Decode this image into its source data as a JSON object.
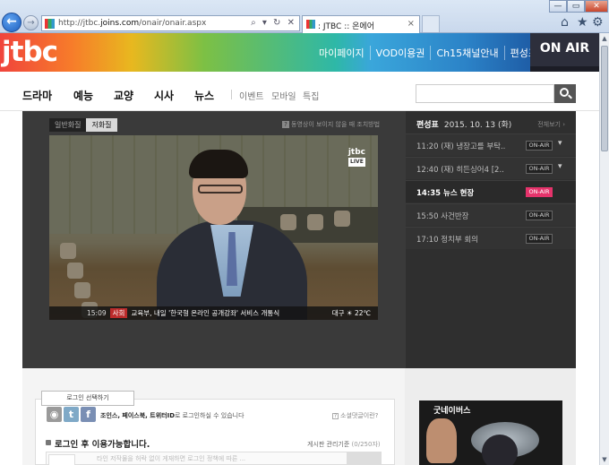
{
  "browser": {
    "url_prefix": "http://jtbc.",
    "url_domain": "joins.com",
    "url_path": "/onair/onair.aspx",
    "url_tools": "⌕ ▾ ↻ ✕",
    "tab_title": ": JTBC :: 온에어",
    "tab_close": "×",
    "back_glyph": "←",
    "fwd_glyph": "→",
    "min_glyph": "—",
    "max_glyph": "▭",
    "close_glyph": "✕",
    "home_glyph": "⌂",
    "fav_glyph": "★",
    "settings_glyph": "⚙"
  },
  "header": {
    "logo": "jtbc",
    "top_menu": [
      "마이페이지",
      "VOD이용권",
      "Ch15채널안내",
      "편성표"
    ],
    "on_air": "ON AIR"
  },
  "gnb": {
    "main": [
      "드라마",
      "예능",
      "교양",
      "시사",
      "뉴스"
    ],
    "sub": [
      "이벤트",
      "모바일",
      "특집"
    ],
    "search_placeholder": ""
  },
  "player": {
    "quality_tabs": [
      "일반화질",
      "저화질"
    ],
    "help_icon": "?",
    "help_text": "동영상이 보이지 않을 때 조치방법",
    "live_logo": "jtbc",
    "live_label": "LIVE",
    "ticker_time": "15:09",
    "ticker_section": "사회",
    "ticker_text": "교육부, 내일 '한국형 온라인 공개강좌' 서비스 개통식",
    "ticker_weather": "대구 ☀ 22℃"
  },
  "schedule": {
    "heading": "편성표",
    "date": "2015. 10. 13 (화)",
    "view_all": "전체보기 ›",
    "items": [
      {
        "time_title": "11:20 (재) 냉장고를 부탁..",
        "badge": "ON-AIR",
        "chevron": "▾"
      },
      {
        "time_title": "12:40 (재) 히든싱어4 [2..",
        "badge": "ON-AIR",
        "chevron": "▾"
      },
      {
        "time_title": "14:35 뉴스 현장",
        "badge": "ON-AIR",
        "chevron": ""
      },
      {
        "time_title": "15:50 사건반장",
        "badge": "ON-AIR",
        "chevron": ""
      },
      {
        "time_title": "17:10 정치부 회의",
        "badge": "ON-AIR",
        "chevron": ""
      }
    ]
  },
  "comments": {
    "login_tip": "로그인 선택하기",
    "sns_glyphs": [
      "◉",
      "t",
      "f"
    ],
    "sns_desc_bold": "조인스, 페이스북, 트위터ID",
    "sns_desc_rest": "로 로그인하실 수 있습니다",
    "help_icon": "?",
    "help_text": "소셜댓글이란?",
    "notice": "로그인 후 이용가능합니다.",
    "policy": "게시판 관리기준",
    "count": "(0/250자)",
    "input_placeholder": "타인 저작물을 허락 없이 게재하면 로그인 정책에 따른 ..."
  },
  "ad": {
    "title": "굿네이버스"
  },
  "colors": {
    "live_badge": "#e5336b",
    "onair_bg": "#2d2f3c",
    "player_bg": "#3a3a3a"
  }
}
